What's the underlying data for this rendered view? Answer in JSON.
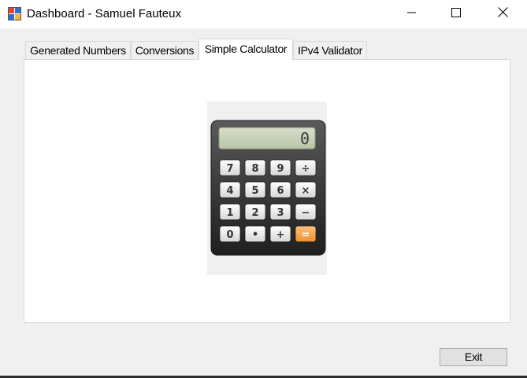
{
  "window": {
    "title": "Dashboard - Samuel Fauteux",
    "icon": "form-icon",
    "controls": [
      "minimize-icon",
      "maximize-icon",
      "close-icon"
    ]
  },
  "tabs": [
    {
      "label": "Generated Numbers",
      "selected": false
    },
    {
      "label": "Conversions",
      "selected": false
    },
    {
      "label": "Simple Calculator",
      "selected": true
    },
    {
      "label": "IPv4 Validator",
      "selected": false
    }
  ],
  "calculator_image": {
    "icon": "calculator-icon",
    "display_value": "0",
    "keys": [
      [
        "7",
        "8",
        "9",
        "÷"
      ],
      [
        "4",
        "5",
        "6",
        "×"
      ],
      [
        "1",
        "2",
        "3",
        "−"
      ],
      [
        "0",
        "•",
        "+",
        "="
      ]
    ]
  },
  "footer": {
    "exit_label": "Exit"
  },
  "colors": {
    "window_bg": "#f0f0f0",
    "titlebar_bg": "#ffffff",
    "accent_orange": "#f5a24a"
  }
}
